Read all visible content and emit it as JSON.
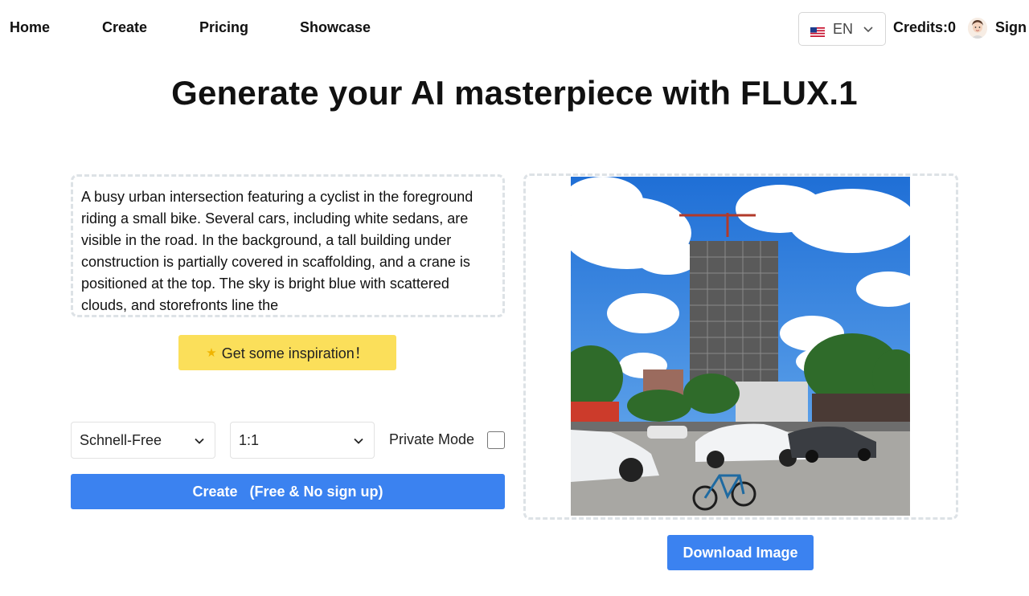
{
  "nav": {
    "items": [
      {
        "label": "Home"
      },
      {
        "label": "Create"
      },
      {
        "label": "Pricing"
      },
      {
        "label": "Showcase"
      }
    ],
    "language": {
      "code": "EN",
      "flag": "us-flag-icon"
    },
    "credits": "Credits:0",
    "sign_label": "Sign"
  },
  "headline": "Generate your AI masterpiece with FLUX.1",
  "prompt": {
    "value": "A busy urban intersection featuring a cyclist in the foreground riding a small bike. Several cars, including white sedans, are visible in the road. In the background, a tall building under construction is partially covered in scaffolding, and a crane is positioned at the top. The sky is bright blue with scattered clouds, and storefronts line the"
  },
  "inspire": {
    "icon": "star-icon",
    "label": "Get some inspiration！"
  },
  "controls": {
    "model": {
      "selected": "Schnell-Free"
    },
    "ratio": {
      "selected": "1:1"
    },
    "private_mode": {
      "label": "Private Mode",
      "checked": false
    },
    "create_label": "Create   (Free & No sign up)"
  },
  "output": {
    "download_label": "Download Image"
  },
  "colors": {
    "accent": "#3b82f0",
    "inspire": "#fbdf5a",
    "border": "#dde2e6"
  }
}
